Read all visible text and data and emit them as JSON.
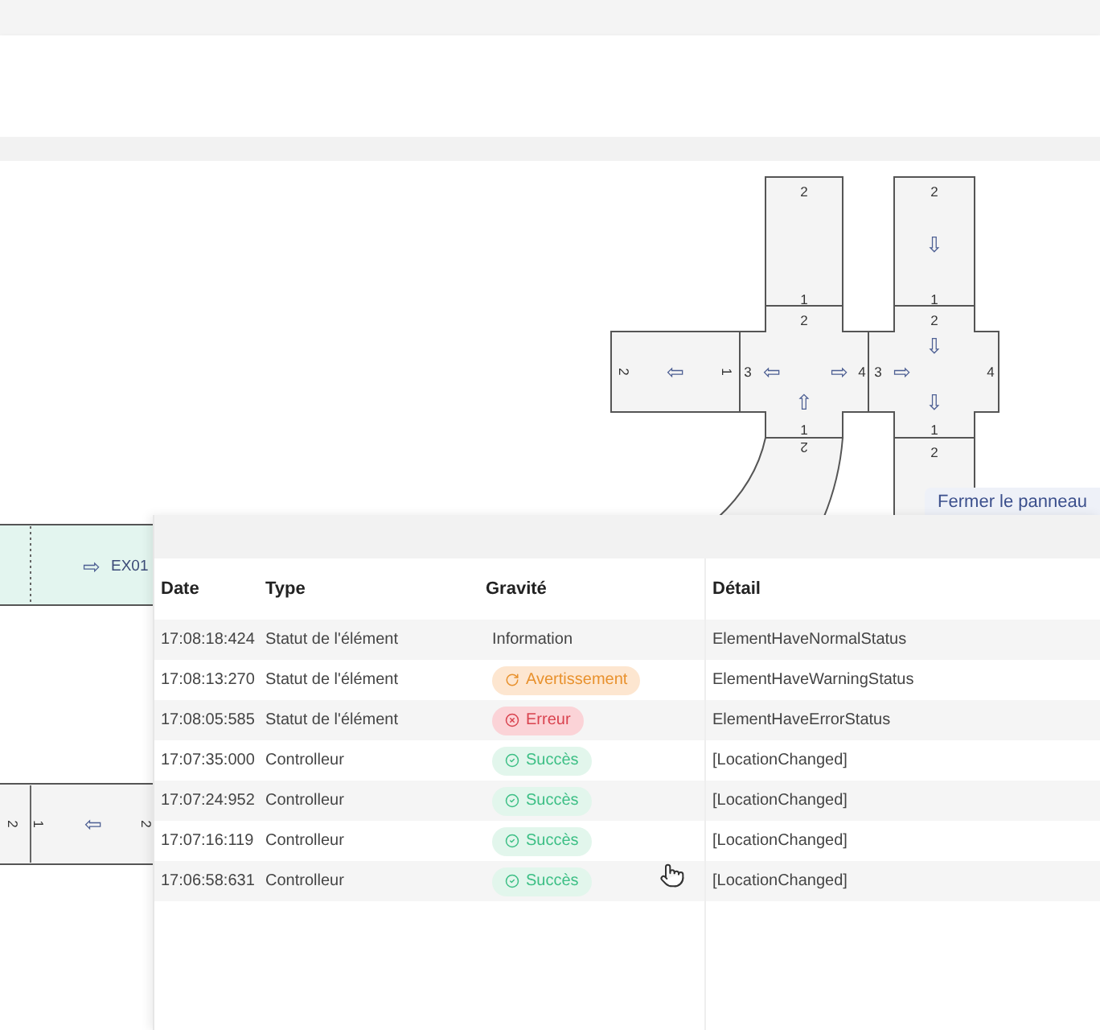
{
  "diagram": {
    "tiles": [
      {
        "kind": "straight",
        "marks": [
          "2",
          "⇦",
          "1"
        ]
      },
      {
        "kind": "straight",
        "marks": [
          "2",
          "1"
        ]
      },
      {
        "kind": "cross",
        "marks": [
          "2",
          "3",
          "⇦",
          "⇨",
          "4",
          "⇧",
          "1"
        ]
      },
      {
        "kind": "curve",
        "marks": [
          "2"
        ]
      },
      {
        "kind": "straight",
        "marks": [
          "2",
          "⇩",
          "1"
        ]
      },
      {
        "kind": "cross",
        "marks": [
          "2",
          "⇩",
          "3",
          "⇨",
          "4",
          "⇩",
          "1"
        ]
      },
      {
        "kind": "straight",
        "marks": [
          "2"
        ]
      },
      {
        "kind": "exit",
        "marks": [
          "⇨",
          "EX01"
        ]
      },
      {
        "kind": "straight",
        "marks": [
          "2",
          "1",
          "⇦",
          "2"
        ]
      }
    ]
  },
  "close_button": "Fermer le panneau",
  "log_table": {
    "columns": [
      "Date",
      "Type",
      "Gravité",
      "Détail"
    ],
    "rows": [
      {
        "date": "17:08:18:424",
        "type": "Statut de l'élément",
        "severity": {
          "kind": "info",
          "label": "Information"
        },
        "detail": "ElementHaveNormalStatus"
      },
      {
        "date": "17:08:13:270",
        "type": "Statut de l'élément",
        "severity": {
          "kind": "warning",
          "label": "Avertissement"
        },
        "detail": "ElementHaveWarningStatus"
      },
      {
        "date": "17:08:05:585",
        "type": "Statut de l'élément",
        "severity": {
          "kind": "error",
          "label": "Erreur"
        },
        "detail": "ElementHaveErrorStatus"
      },
      {
        "date": "17:07:35:000",
        "type": "Controlleur",
        "severity": {
          "kind": "success",
          "label": "Succès"
        },
        "detail": "[LocationChanged]"
      },
      {
        "date": "17:07:24:952",
        "type": "Controlleur",
        "severity": {
          "kind": "success",
          "label": "Succès"
        },
        "detail": "[LocationChanged]"
      },
      {
        "date": "17:07:16:119",
        "type": "Controlleur",
        "severity": {
          "kind": "success",
          "label": "Succès"
        },
        "detail": "[LocationChanged]"
      },
      {
        "date": "17:06:58:631",
        "type": "Controlleur",
        "severity": {
          "kind": "success",
          "label": "Succès"
        },
        "detail": "[LocationChanged]"
      }
    ]
  }
}
